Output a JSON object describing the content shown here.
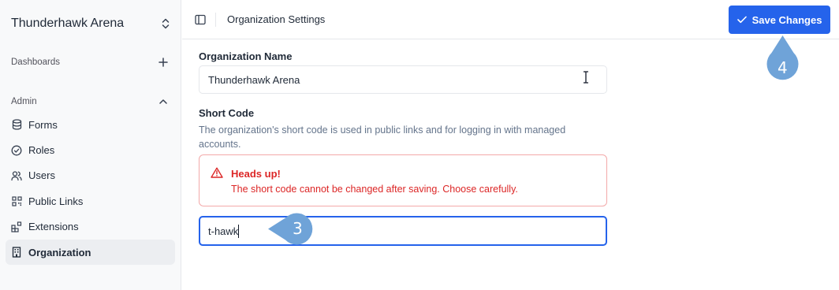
{
  "sidebar": {
    "org_name": "Thunderhawk Arena",
    "sections": {
      "dashboards": "Dashboards",
      "admin": "Admin"
    },
    "items": [
      {
        "label": "Forms",
        "icon": "database-icon"
      },
      {
        "label": "Roles",
        "icon": "check-circle-icon"
      },
      {
        "label": "Users",
        "icon": "users-icon"
      },
      {
        "label": "Public Links",
        "icon": "qr-code-icon"
      },
      {
        "label": "Extensions",
        "icon": "blocks-icon"
      },
      {
        "label": "Organization",
        "icon": "building-icon",
        "active": true
      }
    ]
  },
  "header": {
    "title": "Organization Settings",
    "save_label": "Save Changes"
  },
  "form": {
    "org_name_label": "Organization Name",
    "org_name_value": "Thunderhawk Arena",
    "short_code_label": "Short Code",
    "short_code_help": "The organization's short code is used in public links and for logging in with managed accounts.",
    "alert_title": "Heads up!",
    "alert_message": "The short code cannot be changed after saving. Choose carefully.",
    "short_code_value": "t-hawk"
  },
  "annotations": {
    "step_3": "3",
    "step_4": "4"
  },
  "colors": {
    "accent": "#2563eb",
    "danger": "#dc2626",
    "marker": "#6fa3d8"
  }
}
